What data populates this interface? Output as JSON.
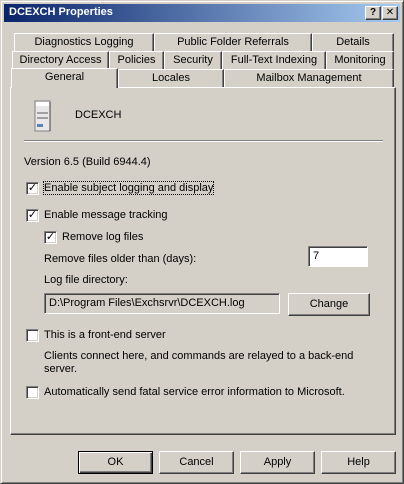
{
  "window": {
    "title": "DCEXCH Properties",
    "help_glyph": "?",
    "close_glyph": "✕"
  },
  "tabs": {
    "row1": [
      "Diagnostics Logging",
      "Public Folder Referrals",
      "Details"
    ],
    "row2": [
      "Directory Access",
      "Policies",
      "Security",
      "Full-Text Indexing",
      "Monitoring"
    ],
    "row3": [
      "General",
      "Locales",
      "Mailbox Management"
    ],
    "active": "General"
  },
  "general": {
    "server_name": "DCEXCH",
    "version": "Version 6.5 (Build 6944.4)",
    "subject_logging": {
      "label": "Enable subject logging and display",
      "checked": true
    },
    "message_tracking": {
      "label": "Enable message tracking",
      "checked": true
    },
    "remove_log_files": {
      "label": "Remove log files",
      "checked": true
    },
    "remove_older_label": "Remove files older than (days):",
    "remove_older_value": "7",
    "log_dir_label": "Log file directory:",
    "log_dir_value": "D:\\Program Files\\Exchsrvr\\DCEXCH.log",
    "change_label": "Change",
    "front_end": {
      "label": "This is a front-end server",
      "checked": false
    },
    "front_end_desc": "Clients connect here, and commands are relayed to a back-end server.",
    "auto_send": {
      "label": "Automatically send fatal service error information to Microsoft.",
      "checked": false
    }
  },
  "buttons": {
    "ok": "OK",
    "cancel": "Cancel",
    "apply": "Apply",
    "help": "Help"
  },
  "colors": {
    "title_start": "#0a246a",
    "title_end": "#a6caf0",
    "face": "#d4d0c8"
  }
}
